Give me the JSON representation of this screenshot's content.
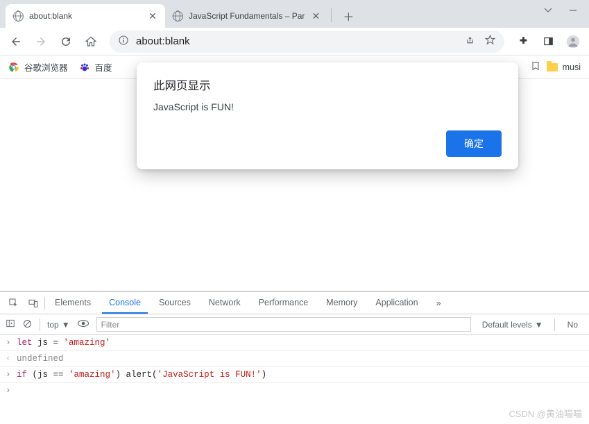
{
  "tabs": [
    {
      "title": "about:blank",
      "active": true
    },
    {
      "title": "JavaScript Fundamentals – Par",
      "active": false
    }
  ],
  "toolbar": {
    "address": "about:blank"
  },
  "bookmarks": {
    "items": [
      {
        "label": "谷歌浏览器"
      },
      {
        "label": "百度"
      }
    ],
    "right_folder": "musi"
  },
  "alert": {
    "title": "此网页显示",
    "message": "JavaScript is FUN!",
    "ok_label": "确定"
  },
  "devtools": {
    "tabs": [
      "Elements",
      "Console",
      "Sources",
      "Network",
      "Performance",
      "Memory",
      "Application"
    ],
    "active_tab": "Console",
    "context_label": "top",
    "filter_placeholder": "Filter",
    "levels_label": "Default levels",
    "no_issues_label": "No",
    "console_lines": [
      {
        "kind": "input",
        "prefix": "let",
        "mid": " js = ",
        "str": "'amazing'"
      },
      {
        "kind": "result",
        "text": "undefined"
      },
      {
        "kind": "input2",
        "prefix": "if",
        "mid1": " (js == ",
        "str1": "'amazing'",
        "mid2": ") alert(",
        "str2": "'JavaScript is FUN!'",
        "mid3": ")"
      }
    ]
  },
  "watermark": "CSDN @黄油喵喵"
}
